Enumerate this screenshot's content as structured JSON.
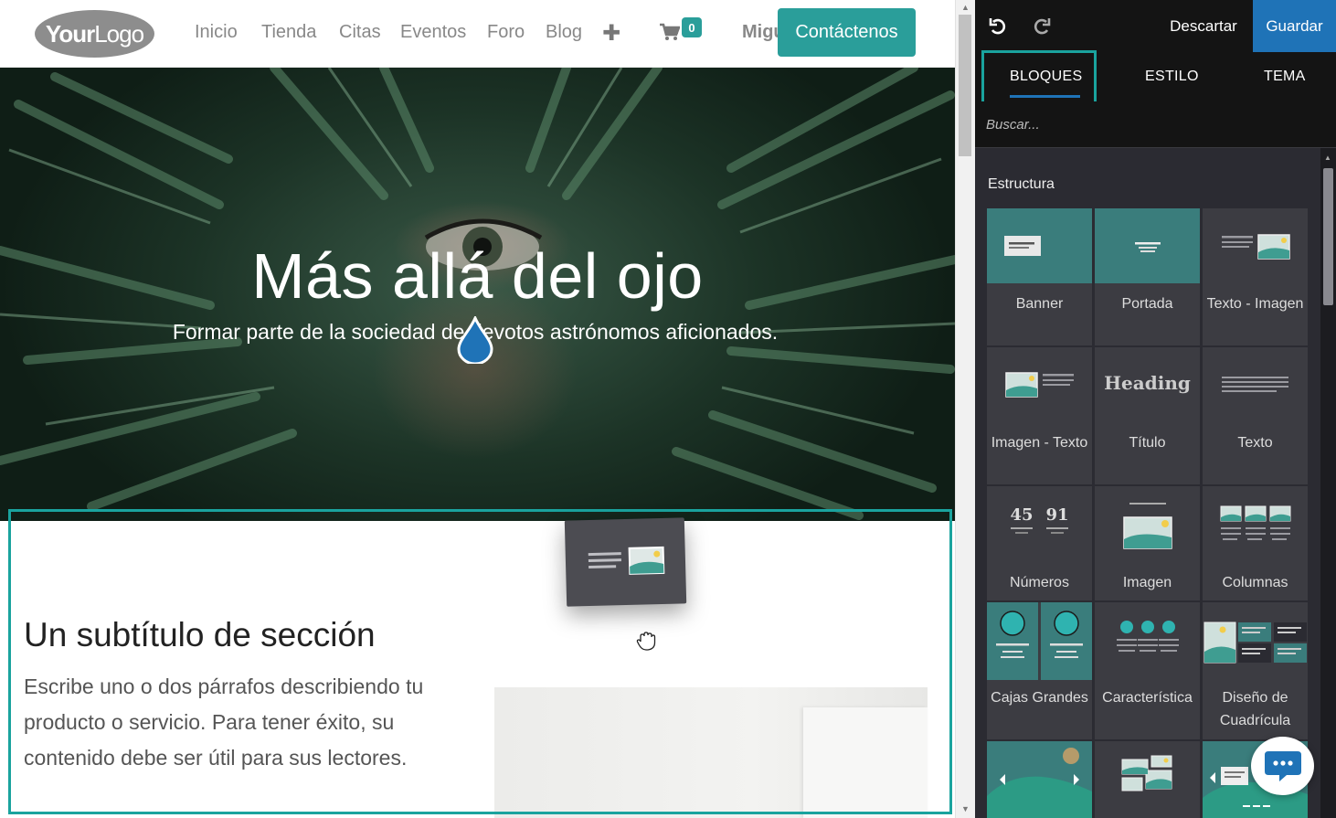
{
  "navbar": {
    "logo": "YourLogo",
    "links": [
      "Inicio",
      "Tienda",
      "Citas",
      "Eventos",
      "Foro",
      "Blog"
    ],
    "cart_count": "0",
    "user": "Migu",
    "contact_label": "Contáctenos"
  },
  "hero": {
    "title": "Más allá del ojo",
    "subtitle": "Formar parte de la sociedad de devotos astrónomos aficionados."
  },
  "section": {
    "title": "Un subtítulo de sección",
    "text": "Escribe uno o dos párrafos describiendo tu producto o servicio. Para tener éxito, su contenido debe ser útil para sus lectores."
  },
  "editor": {
    "discard_label": "Descartar",
    "save_label": "Guardar",
    "tabs": [
      "BLOQUES",
      "ESTILO",
      "TEMA"
    ],
    "search_placeholder": "Buscar...",
    "category": "Estructura",
    "blocks": [
      {
        "label": "Banner",
        "icon": "banner-icon"
      },
      {
        "label": "Portada",
        "icon": "cover-icon"
      },
      {
        "label": "Texto - Imagen",
        "icon": "text-image-icon"
      },
      {
        "label": "Imagen - Texto",
        "icon": "image-text-icon"
      },
      {
        "label": "Título",
        "icon": "heading-icon",
        "preview_text": "Heading"
      },
      {
        "label": "Texto",
        "icon": "text-icon"
      },
      {
        "label": "Números",
        "icon": "numbers-icon",
        "preview_numbers": [
          "45",
          "91"
        ]
      },
      {
        "label": "Imagen",
        "icon": "image-icon"
      },
      {
        "label": "Columnas",
        "icon": "columns-icon"
      },
      {
        "label": "Cajas Grandes",
        "icon": "big-boxes-icon"
      },
      {
        "label": "Característica",
        "icon": "features-icon"
      },
      {
        "label": "Diseño de Cuadrícula",
        "icon": "grid-layout-icon"
      },
      {
        "label": "",
        "icon": "carousel-icon"
      },
      {
        "label": "",
        "icon": "masonry-icon"
      },
      {
        "label": "",
        "icon": "text-slider-icon"
      }
    ]
  },
  "colors": {
    "accent_teal": "#2a9e9a",
    "save_blue": "#1f73b7",
    "panel_bg": "#2b2b32",
    "highlight": "#1aa39e"
  }
}
